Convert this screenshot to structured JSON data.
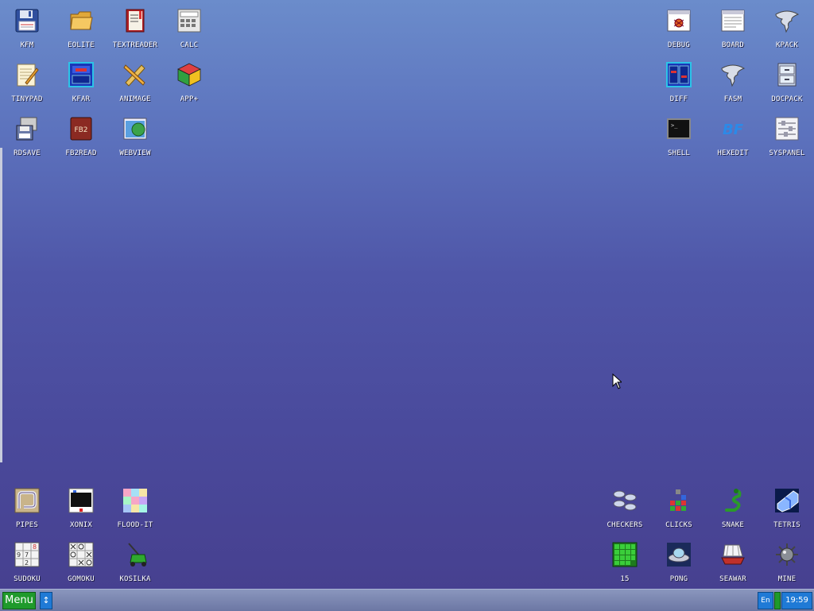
{
  "desktop_icons": [
    {
      "label": "KFM",
      "icon": "floppy-disk-icon"
    },
    {
      "label": "EOLITE",
      "icon": "folder-icon"
    },
    {
      "label": "TEXTREADER",
      "icon": "book-icon"
    },
    {
      "label": "CALC",
      "icon": "calculator-icon"
    },
    {
      "label": "TINYPAD",
      "icon": "notepad-icon"
    },
    {
      "label": "KFAR",
      "icon": "dual-panel-icon"
    },
    {
      "label": "ANIMAGE",
      "icon": "pencil-ruler-icon"
    },
    {
      "label": "APP+",
      "icon": "cube-icon"
    },
    {
      "label": "RDSAVE",
      "icon": "save-disk-icon"
    },
    {
      "label": "FB2READ",
      "icon": "fb2-book-icon"
    },
    {
      "label": "WEBVIEW",
      "icon": "globe-window-icon"
    },
    {
      "label": "DEBUG",
      "icon": "bug-window-icon"
    },
    {
      "label": "BOARD",
      "icon": "board-window-icon"
    },
    {
      "label": "KPACK",
      "icon": "tornado-icon"
    },
    {
      "label": "DIFF",
      "icon": "diff-panels-icon"
    },
    {
      "label": "FASM",
      "icon": "tornado-icon"
    },
    {
      "label": "DOCPACK",
      "icon": "cabinet-icon"
    },
    {
      "label": "SHELL",
      "icon": "terminal-icon"
    },
    {
      "label": "HEXEDIT",
      "icon": "bf-logo-icon"
    },
    {
      "label": "SYSPANEL",
      "icon": "sliders-icon"
    },
    {
      "label": "PIPES",
      "icon": "pipes-icon"
    },
    {
      "label": "XONIX",
      "icon": "xonix-icon"
    },
    {
      "label": "FLOOD-IT",
      "icon": "color-grid-icon"
    },
    {
      "label": "SUDOKU",
      "icon": "sudoku-grid-icon"
    },
    {
      "label": "GOMOKU",
      "icon": "xo-grid-icon"
    },
    {
      "label": "KOSILKA",
      "icon": "lawnmower-icon"
    },
    {
      "label": "CHECKERS",
      "icon": "checkers-icon"
    },
    {
      "label": "CLICKS",
      "icon": "blocks-icon"
    },
    {
      "label": "SNAKE",
      "icon": "snake-icon"
    },
    {
      "label": "TETRIS",
      "icon": "tetris-icon"
    },
    {
      "label": "15",
      "icon": "puzzle-grid-icon"
    },
    {
      "label": "PONG",
      "icon": "ufo-icon"
    },
    {
      "label": "SEAWAR",
      "icon": "ship-icon"
    },
    {
      "label": "MINE",
      "icon": "mine-icon"
    }
  ],
  "taskbar": {
    "menu_label": "Menu",
    "layout_toggle": "↕",
    "language": "En",
    "clock": "19:59"
  }
}
